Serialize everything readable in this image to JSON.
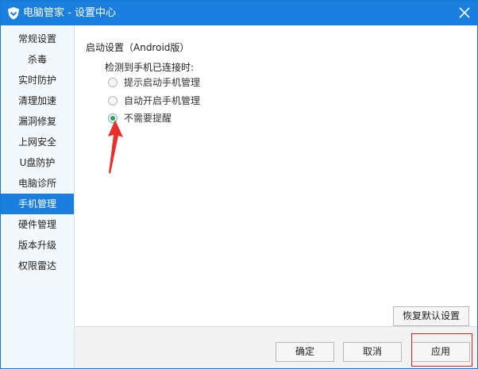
{
  "window": {
    "title": "电脑管家 - 设置中心",
    "logo_icon": "shield-logo-icon",
    "close_icon": "close-icon"
  },
  "sidebar": {
    "items": [
      {
        "label": "常规设置",
        "active": false
      },
      {
        "label": "杀毒",
        "active": false
      },
      {
        "label": "实时防护",
        "active": false
      },
      {
        "label": "清理加速",
        "active": false
      },
      {
        "label": "漏洞修复",
        "active": false
      },
      {
        "label": "上网安全",
        "active": false
      },
      {
        "label": "U盘防护",
        "active": false
      },
      {
        "label": "电脑诊所",
        "active": false
      },
      {
        "label": "手机管理",
        "active": true
      },
      {
        "label": "硬件管理",
        "active": false
      },
      {
        "label": "版本升级",
        "active": false
      },
      {
        "label": "权限雷达",
        "active": false
      }
    ]
  },
  "main": {
    "section_title": "启动设置（Android版）",
    "detect_label": "检测到手机已连接时:",
    "options": [
      {
        "label": "提示启动手机管理",
        "checked": false
      },
      {
        "label": "自动开启手机管理",
        "checked": false
      },
      {
        "label": "不需要提醒",
        "checked": true
      }
    ],
    "restore_default_label": "恢复默认设置"
  },
  "footer": {
    "ok_label": "确定",
    "cancel_label": "取消",
    "apply_label": "应用"
  },
  "colors": {
    "titlebar": "#1b7fe0",
    "active_item": "#1b7fe0",
    "radio_checked": "#2aa44a",
    "annotation": "#e02020"
  }
}
